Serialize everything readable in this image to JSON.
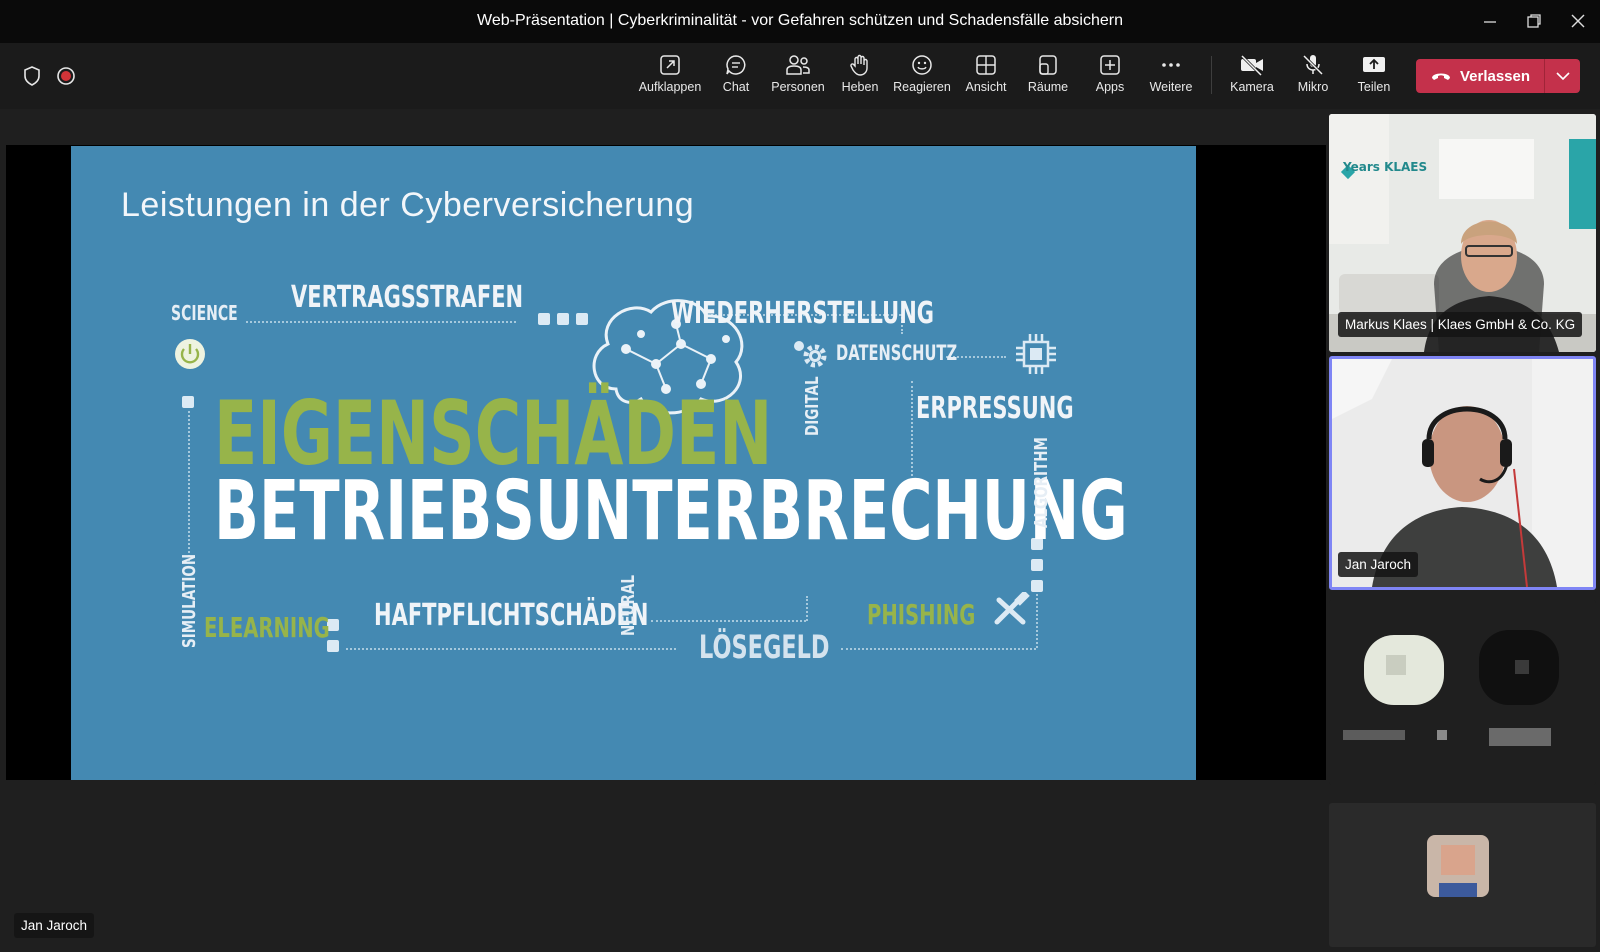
{
  "window": {
    "title": "Web-Präsentation | Cyberkriminalität - vor Gefahren schützen und Schadensfälle absichern"
  },
  "toolbar": {
    "tools": [
      {
        "id": "aufklappen",
        "label": "Aufklappen",
        "icon": "popout-icon"
      },
      {
        "id": "chat",
        "label": "Chat",
        "icon": "chat-icon"
      },
      {
        "id": "personen",
        "label": "Personen",
        "icon": "people-icon"
      },
      {
        "id": "heben",
        "label": "Heben",
        "icon": "raise-hand-icon"
      },
      {
        "id": "reagieren",
        "label": "Reagieren",
        "icon": "smiley-icon"
      },
      {
        "id": "ansicht",
        "label": "Ansicht",
        "icon": "grid-icon"
      },
      {
        "id": "raeume",
        "label": "Räume",
        "icon": "rooms-icon"
      },
      {
        "id": "apps",
        "label": "Apps",
        "icon": "plus-square-icon"
      },
      {
        "id": "weitere",
        "label": "Weitere",
        "icon": "more-icon"
      },
      {
        "id": "kamera",
        "label": "Kamera",
        "icon": "camera-off-icon"
      },
      {
        "id": "mikro",
        "label": "Mikro",
        "icon": "mic-off-icon"
      },
      {
        "id": "teilen",
        "label": "Teilen",
        "icon": "share-icon"
      }
    ],
    "leave_label": "Verlassen",
    "leave_color": "#c4314b"
  },
  "slide": {
    "title": "Leistungen in der Cyberversicherung",
    "words": {
      "science": "SCIENCE",
      "vertragsstrafen": "VERTRAGSSTRAFEN",
      "wiederherstellung": "WIEDERHERSTELLUNG",
      "datenschutz": "DATENSCHUTZ",
      "digital": "DIGITAL",
      "erpressung": "ERPRESSUNG",
      "eigenschaeden": "EIGENSCHÄDEN",
      "betriebsunterbrechung": "BETRIEBSUNTERBRECHUNG",
      "algorithm": "ALGORITHM",
      "simulation": "SIMULATION",
      "elearning": "ELEARNING",
      "haftpflichtschaeden": "HAFTPFLICHTSCHÄDEN",
      "neural": "NEURAL",
      "loesegeld": "LÖSEGELD",
      "phishing": "PHISHING"
    },
    "background": "#4489b2",
    "accent_green": "#97b44a"
  },
  "participants": {
    "presenter_label": "Jan Jaroch",
    "tile1_name": "Markus Klaes | Klaes GmbH & Co. KG",
    "tile2_name": "Jan Jaroch",
    "backdrop_text": "Years KLAES"
  }
}
